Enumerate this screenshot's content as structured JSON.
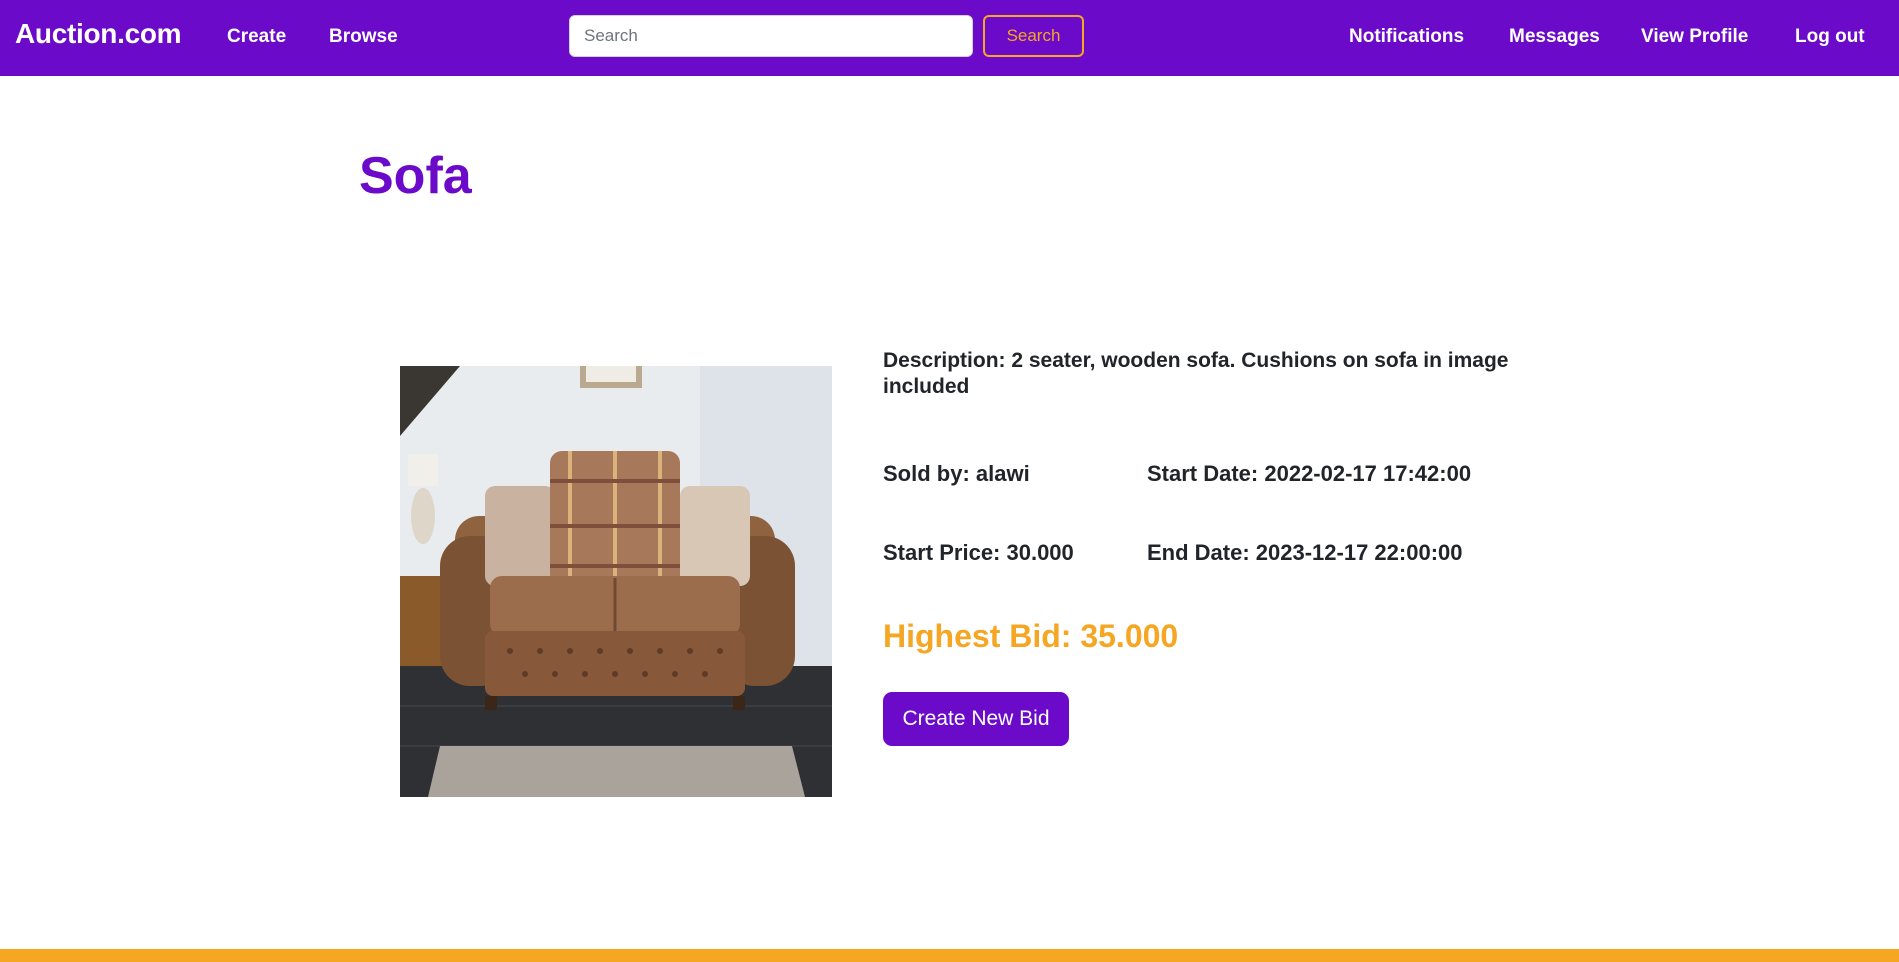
{
  "navbar": {
    "brand": "Auction.com",
    "links": {
      "create": "Create",
      "browse": "Browse",
      "notifications": "Notifications",
      "messages": "Messages",
      "view_profile": "View Profile",
      "log_out": "Log out"
    },
    "search": {
      "placeholder": "Search",
      "value": "",
      "button_label": "Search"
    }
  },
  "item": {
    "title": "Sofa",
    "image_icon": "sofa-photo",
    "description": "Description: 2 seater, wooden sofa. Cushions on sofa in image included",
    "sold_by": "Sold by: alawi",
    "start_date": "Start Date: 2022-02-17 17:42:00",
    "start_price": "Start Price: 30.000",
    "end_date": "End Date: 2023-12-17 22:00:00",
    "highest_bid": "Highest Bid: 35.000",
    "bid_button_label": "Create New Bid"
  },
  "colors": {
    "primary": "#6b0ac9",
    "accent": "#f5a623",
    "text": "#212529",
    "background": "#ffffff"
  }
}
